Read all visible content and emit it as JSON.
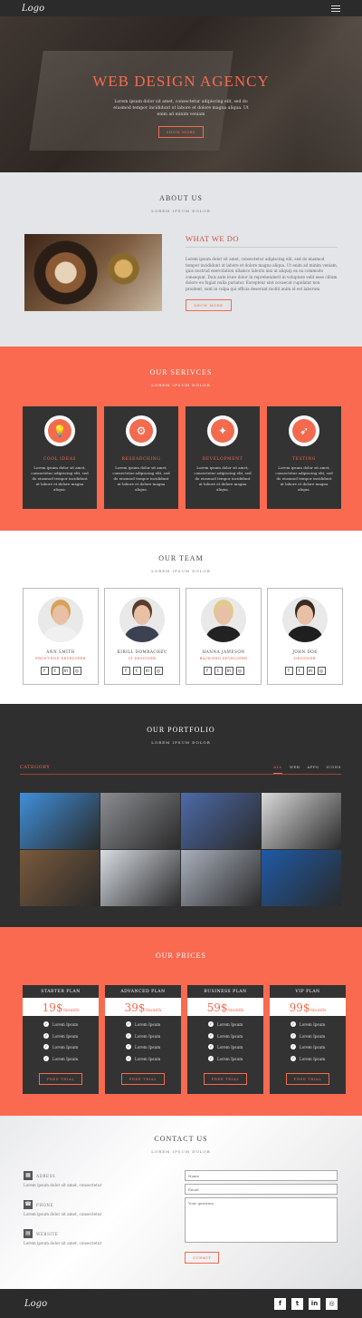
{
  "nav": {
    "logo": "Logo"
  },
  "hero": {
    "title": "WEB DESIGN AGENCY",
    "text": "Lorem ipsum dolor sit amet, consectetur adipiscing elit, sed do eiusmod tempor incididunt ut labore et dolore magna aliqua. Ut enim ad minim veniam",
    "button": "SHOW MORE"
  },
  "about": {
    "title": "ABOUT US",
    "subtitle": "LOREM IPSUM DOLOR",
    "heading": "WHAT WE DO",
    "text": "Lorem ipsum dolor sit amet, consectetur adipiscing elit, sed do eiusmod tempor incididunt ut labore et dolore magna aliqua. Ut enim ad minim veniam, quis nostrud exercitation ullamco laboris nisi ut aliquip ex ea commodo consequat. Duis aute irure dolor in reprehenderit in voluptate velit esse cillum dolore eu fugiat nulla pariatur. Excepteur sint occaecat cupidatat non proident, sunt in culpa qui officia deserunt mollit anim id est laborum",
    "button": "SHOW MORE"
  },
  "services": {
    "title": "OUR SERIVCES",
    "subtitle": "LOREM IPSUM DOLOR",
    "items": [
      {
        "title": "COOL IDEAS",
        "icon": "lightbulb-icon",
        "glyph": "💡",
        "text": "Lorem ipsum dolor sit amet, consectetur adipiscing elit, sed do eiusmod tempor incididunt ut labore et dolore magna aliqua."
      },
      {
        "title": "RESEARCHING",
        "icon": "gears-icon",
        "glyph": "⚙",
        "text": "Lorem ipsum dolor sit amet, consectetur adipiscing elit, sed do eiusmod tempor incididunt ut labore et dolore magna aliqua."
      },
      {
        "title": "DEVELOPMENT",
        "icon": "magic-wand-icon",
        "glyph": "✦",
        "text": "Lorem ipsum dolor sit amet, consectetur adipiscing elit, sed do eiusmod tempor incididunt ut labore et dolore magna aliqua."
      },
      {
        "title": "TESTING",
        "icon": "rocket-icon",
        "glyph": "➶",
        "text": "Lorem ipsum dolor sit amet, consectetur adipiscing elit, sed do eiusmod tempor incididunt ut labore et dolore magna aliqua."
      }
    ]
  },
  "team": {
    "title": "OUR TEAM",
    "subtitle": "LOREM IPSUM DOLOR",
    "members": [
      {
        "name": "ANN SMITH",
        "role": "FRONT-END DEVELOPER",
        "hair": "#d7a35a",
        "shirt": "#f0f0f0"
      },
      {
        "name": "KIRILL DOMRACHEV",
        "role": "UI DESIGNER",
        "hair": "#5a3d2a",
        "shirt": "#3c4252"
      },
      {
        "name": "HANNA JAMESON",
        "role": "BACK-END DEVELOPER",
        "hair": "#e4c98e",
        "shirt": "#222222"
      },
      {
        "name": "JOHN DOE",
        "role": "DESIGNER",
        "hair": "#3a2a22",
        "shirt": "#1f1f1f"
      }
    ],
    "social": [
      "f",
      "t",
      "in",
      "◎"
    ]
  },
  "portfolio": {
    "title": "OUR PORTFOLIO",
    "subtitle": "LOREM IPSUM DOLOR",
    "category": "CATEGORY",
    "filters": [
      "ALL",
      "WEB",
      "APPS",
      "ICONS"
    ],
    "tiles": [
      "#3f8fd9",
      "#8b8d91",
      "#4d6aa8",
      "#d9d9d9",
      "#7a5a3c",
      "#d8dde3",
      "#a9b0bd",
      "#1f5aa6"
    ]
  },
  "prices": {
    "title": "OUR PRICES",
    "plans": [
      {
        "name": "STARTER PLAN",
        "price": "19$",
        "per": "/month",
        "features": [
          "Lorem Ipsum",
          "Lorem Ipsum",
          "Lorem Ipsum",
          "Lorem Ipsum"
        ]
      },
      {
        "name": "ADVANCED PLAN",
        "price": "39$",
        "per": "/month",
        "features": [
          "Lorem Ipsum",
          "Lorem Ipsum",
          "Lorem Ipsum",
          "Lorem Ipsum"
        ]
      },
      {
        "name": "BUSINESS PLAN",
        "price": "59$",
        "per": "/month",
        "features": [
          "Lorem Ipsum",
          "Lorem Ipsum",
          "Lorem Ipsum",
          "Lorem Ipsum"
        ]
      },
      {
        "name": "VIP PLAN",
        "price": "99$",
        "per": "/month",
        "features": [
          "Lorem Ipsum",
          "Lorem Ipsum",
          "Lorem Ipsum",
          "Lorem Ipsum"
        ]
      }
    ],
    "button": "FREE TRIAL"
  },
  "contact": {
    "title": "CONTACT US",
    "subtitle": "LOREM IPSUM DOLOR",
    "items": [
      {
        "label": "ADRESS",
        "value": "Lorem ipsum dolor sit amet, consectetur"
      },
      {
        "label": "PHONE",
        "value": "Lorem ipsum dolor sit amet, consectetur"
      },
      {
        "label": "WEBSITE",
        "value": "Lorem ipsum dolor sit amet, consectetur"
      }
    ],
    "placeholders": {
      "name": "Name",
      "email": "Email",
      "question": "Your question"
    },
    "button": "SUBMIT"
  },
  "footer": {
    "logo": "Logo",
    "social": [
      "f",
      "t",
      "in",
      "◎"
    ]
  },
  "colors": {
    "accent": "#f26b4f",
    "dark": "#333333"
  }
}
